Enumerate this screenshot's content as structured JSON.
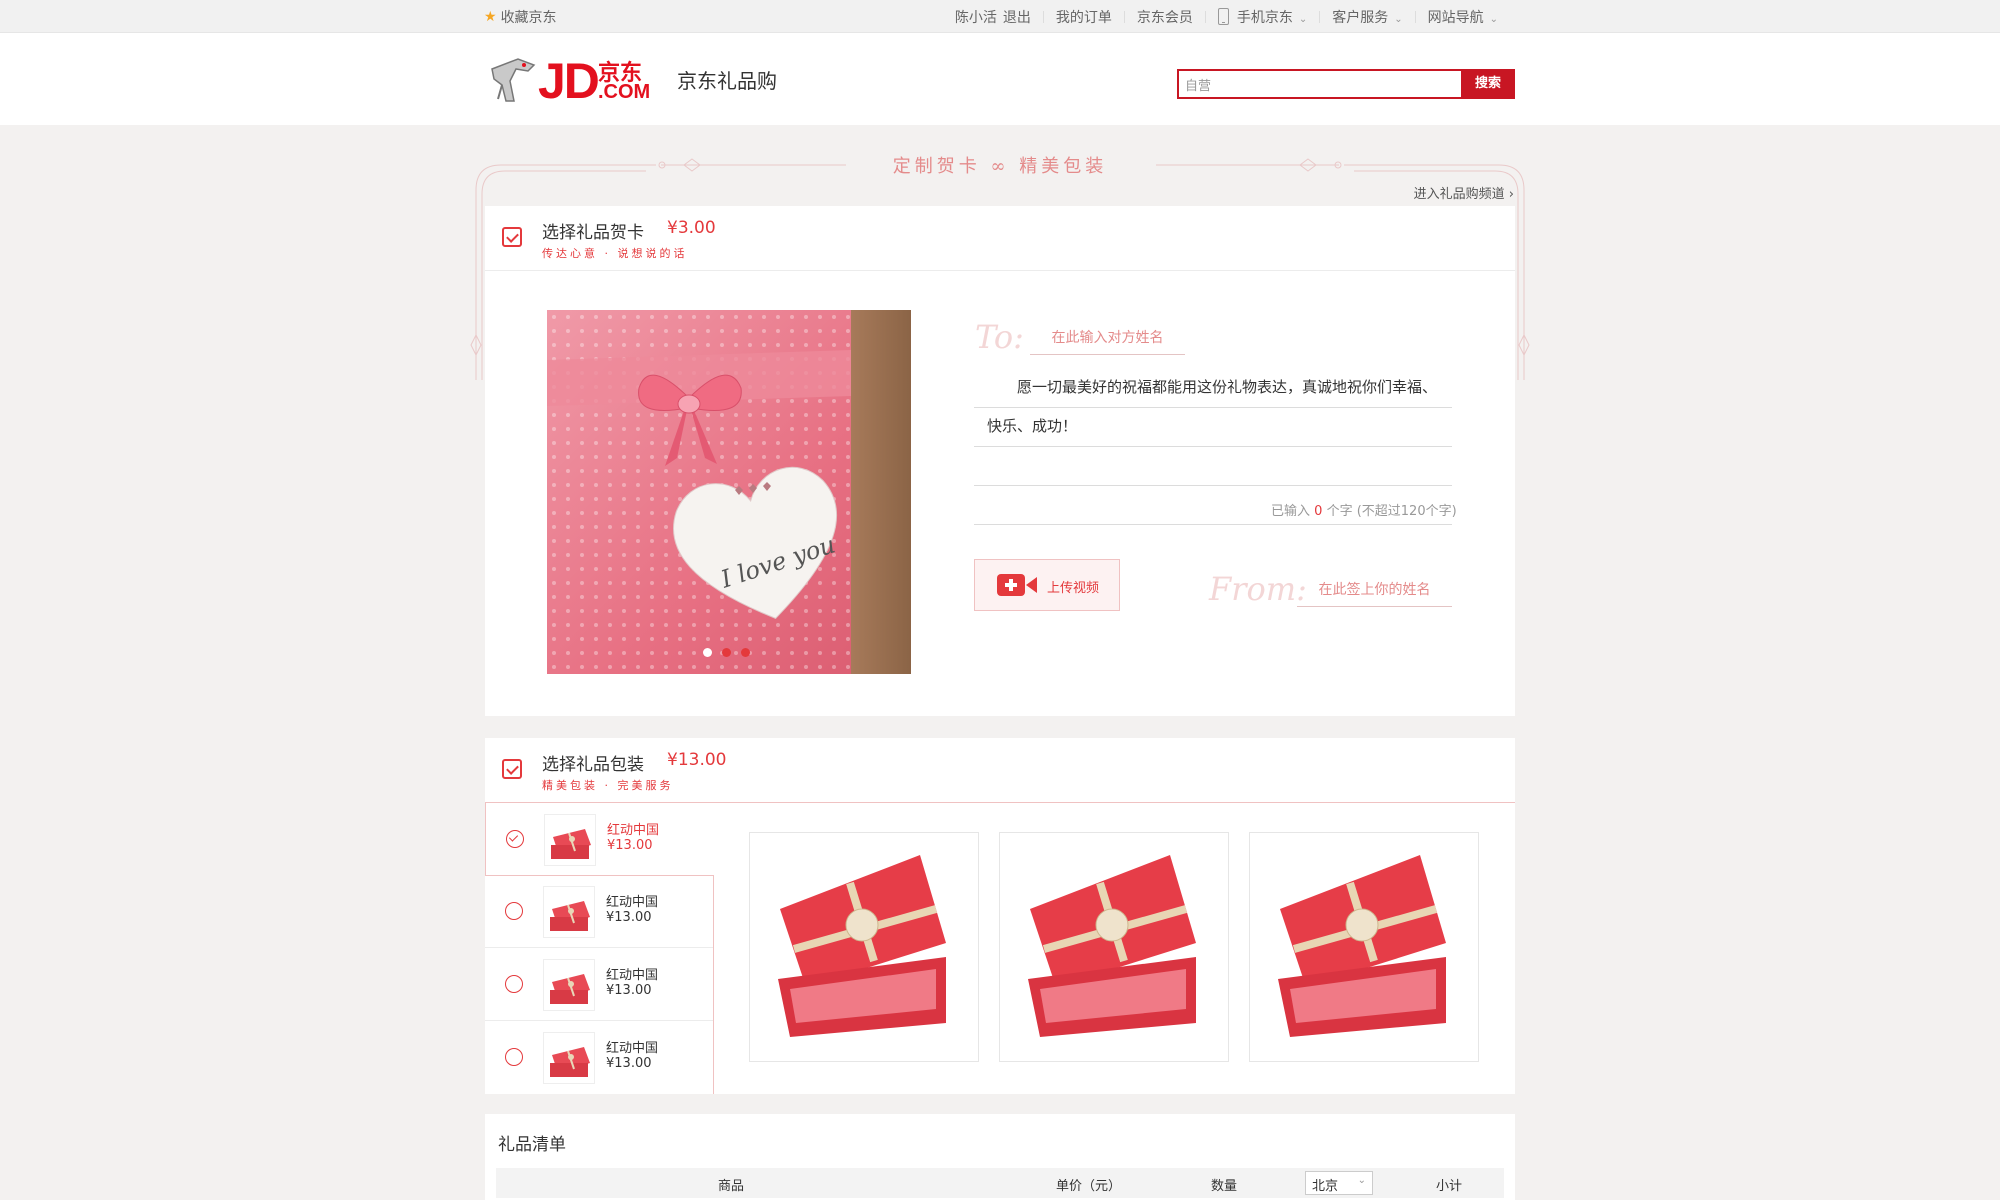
{
  "topbar": {
    "favorite": "收藏京东",
    "user": "陈小活",
    "logout": "退出",
    "orders": "我的订单",
    "member": "京东会员",
    "mobile": "手机京东",
    "service": "客户服务",
    "sitenav": "网站导航"
  },
  "header": {
    "logo_jd": "JD",
    "logo_cn": "京东",
    "logo_com": ".COM",
    "site_title": "京东礼品购",
    "search_placeholder": "自营",
    "search_button": "搜索"
  },
  "banner": {
    "title": "定制贺卡 ∞ 精美包装",
    "enter_channel": "进入礼品购频道 ›"
  },
  "greeting_card": {
    "title": "选择礼品贺卡",
    "price": "¥3.00",
    "subtitle": "传达心意 · 说想说的话",
    "to_label": "To:",
    "to_placeholder": "在此输入对方姓名",
    "message_line1": "愿一切最美好的祝福都能用这份礼物表达，真诚地祝你们幸福、",
    "message_line2": "快乐、成功！",
    "count_prefix": "已输入",
    "count_value": "0",
    "count_suffix": "个字 (不超过120个字)",
    "upload_video": "上传视频",
    "from_label": "From:",
    "from_placeholder": "在此签上你的姓名",
    "image_text": "I love you"
  },
  "packaging": {
    "title": "选择礼品包装",
    "price": "¥13.00",
    "subtitle": "精美包装 · 完美服务",
    "items": [
      {
        "name": "红动中国",
        "price": "¥13.00"
      },
      {
        "name": "红动中国",
        "price": "¥13.00"
      },
      {
        "name": "红动中国",
        "price": "¥13.00"
      },
      {
        "name": "红动中国",
        "price": "¥13.00"
      }
    ],
    "selected_index": 0
  },
  "gift_list": {
    "title": "礼品清单",
    "columns": {
      "product": "商品",
      "unit_price": "单价（元）",
      "quantity": "数量",
      "city": "北京",
      "subtotal": "小计"
    }
  },
  "colors": {
    "brand_red": "#e4393c",
    "search_red": "#c81623",
    "pink_text": "#e48b8b"
  }
}
